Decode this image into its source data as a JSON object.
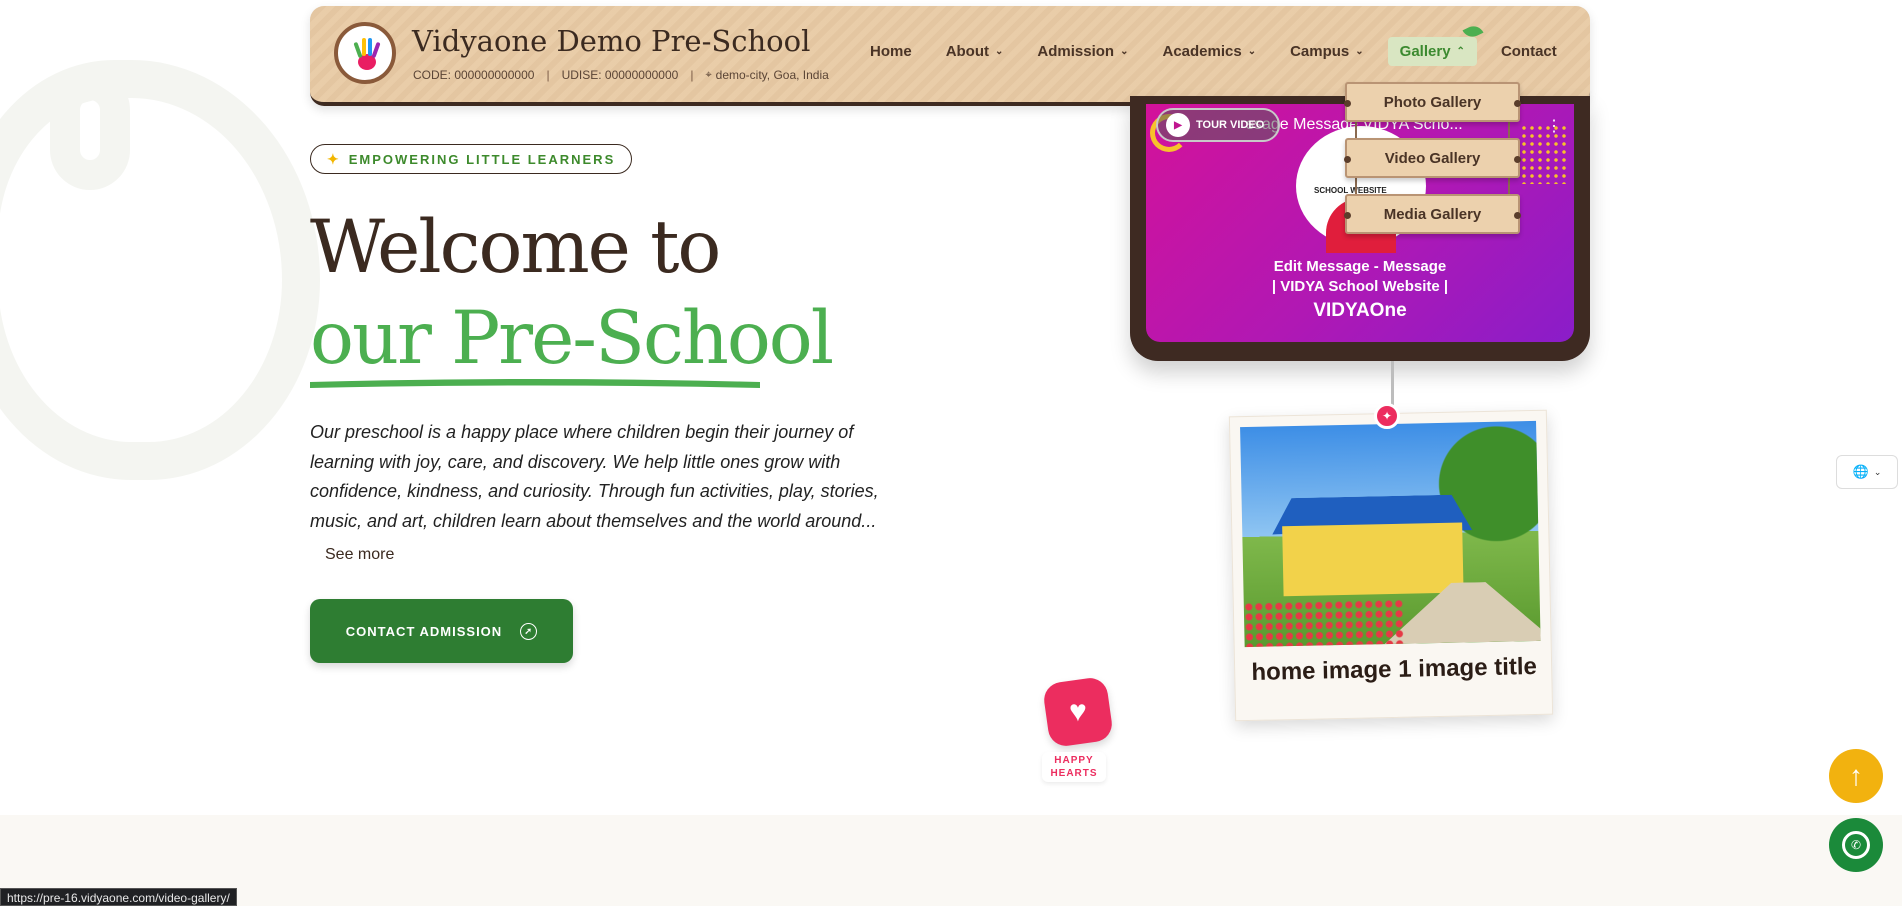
{
  "header": {
    "school_name": "Vidyaone Demo Pre-School",
    "code": "CODE: 000000000000",
    "udise": "UDISE: 00000000000",
    "location": "demo-city, Goa, India",
    "nav": [
      {
        "label": "Home",
        "has_dropdown": false
      },
      {
        "label": "About",
        "has_dropdown": true
      },
      {
        "label": "Admission",
        "has_dropdown": true
      },
      {
        "label": "Academics",
        "has_dropdown": true
      },
      {
        "label": "Campus",
        "has_dropdown": true
      },
      {
        "label": "Gallery",
        "has_dropdown": true,
        "active": true
      },
      {
        "label": "Contact",
        "has_dropdown": false
      }
    ],
    "gallery_menu": [
      "Photo Gallery",
      "Video Gallery",
      "Media Gallery"
    ]
  },
  "hero": {
    "badge": "EMPOWERING LITTLE LEARNERS",
    "title_line1": "Welcome to",
    "title_line2": "our Pre-School",
    "description": "Our preschool is a happy place where children begin their journey of learning with joy, care, and discovery. We help little ones grow with confidence, kindness, and curiosity. Through fun activities, play, stories, music, and art, children learn about themselves and the world around...",
    "see_more": "See more",
    "cta": "CONTACT ADMISSION"
  },
  "video": {
    "tour_label": "TOUR VIDEO",
    "yt_title": "ssage Message VIDYA Scho...",
    "logo_text": "SCHOOL WEBSITE",
    "caption1": "Edit Message - Message",
    "caption2": "| VIDYA School Website |",
    "caption3": "VIDYAOne"
  },
  "polaroid": {
    "caption": "home image 1 image title"
  },
  "happy_hearts": "HAPPY HEARTS",
  "status_url": "https://pre-16.vidyaone.com/video-gallery/",
  "colors": {
    "brand_green": "#2e7d32",
    "accent_green": "#4caf50",
    "header_bg": "#e8caa4",
    "dark_brown": "#3e2a20",
    "pink": "#ec2d5f",
    "yellow": "#f2b20f"
  }
}
